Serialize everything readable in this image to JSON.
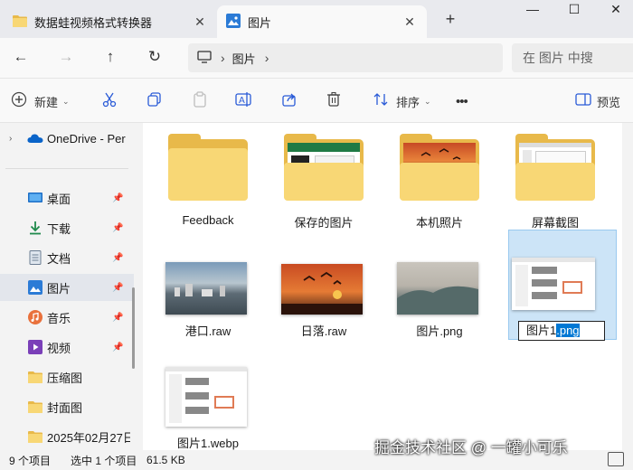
{
  "tabs": [
    {
      "label": "数据蛙视频格式转换器",
      "icon": "folder-icon"
    },
    {
      "label": "图片",
      "icon": "pictures-icon"
    }
  ],
  "window": {
    "minimize": "—",
    "maximize": "☐",
    "close": "✕",
    "new_tab": "+"
  },
  "nav": {
    "back": "←",
    "forward": "→",
    "up": "↑",
    "refresh": "↻"
  },
  "address": {
    "crumb": "图片",
    "separator": "›"
  },
  "search": {
    "placeholder": "在 图片 中搜"
  },
  "toolbar": {
    "new_label": "新建",
    "sort_label": "排序",
    "more": "•••",
    "preview_label": "预览"
  },
  "sidebar": {
    "items": [
      {
        "label": "OneDrive - Per",
        "icon": "onedrive-icon"
      },
      {
        "label": "桌面",
        "icon": "desktop-icon",
        "pinned": true
      },
      {
        "label": "下载",
        "icon": "download-icon",
        "pinned": true
      },
      {
        "label": "文档",
        "icon": "documents-icon",
        "pinned": true
      },
      {
        "label": "图片",
        "icon": "pictures-icon",
        "pinned": true
      },
      {
        "label": "音乐",
        "icon": "music-icon",
        "pinned": true
      },
      {
        "label": "视频",
        "icon": "videos-icon",
        "pinned": true
      },
      {
        "label": "压缩图",
        "icon": "folder-icon"
      },
      {
        "label": "封面图",
        "icon": "folder-icon"
      },
      {
        "label": "2025年02月27日",
        "icon": "folder-icon"
      }
    ]
  },
  "files": [
    {
      "label": "Feedback",
      "type": "folder"
    },
    {
      "label": "保存的图片",
      "type": "folder"
    },
    {
      "label": "本机照片",
      "type": "folder"
    },
    {
      "label": "屏幕截图",
      "type": "folder"
    },
    {
      "label": "港口.raw",
      "type": "image"
    },
    {
      "label": "日落.raw",
      "type": "image"
    },
    {
      "label": "图片.png",
      "type": "image"
    },
    {
      "label": "图片1.png",
      "type": "image",
      "rename_base": "图片1",
      "rename_ext": ".png"
    },
    {
      "label": "图片1.webp",
      "type": "image"
    }
  ],
  "status": {
    "count": "9 个项目",
    "selection": "选中 1 个项目",
    "size": "61.5 KB"
  },
  "watermark": "掘金技术社区 @ 一罐小可乐",
  "colors": {
    "accent": "#0078d4",
    "folder": "#f8d775",
    "selection": "#cce4f7"
  }
}
